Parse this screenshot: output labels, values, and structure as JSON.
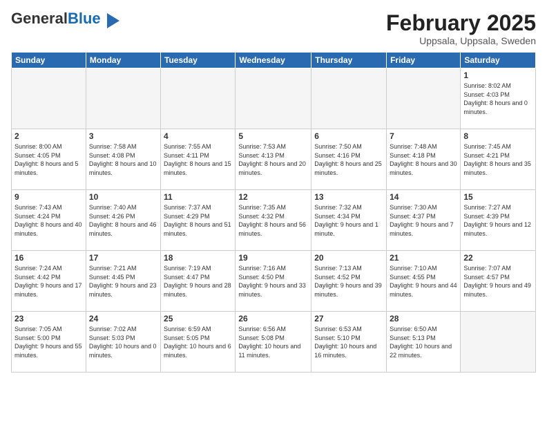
{
  "logo": {
    "general": "General",
    "blue": "Blue"
  },
  "title": "February 2025",
  "subtitle": "Uppsala, Uppsala, Sweden",
  "headers": [
    "Sunday",
    "Monday",
    "Tuesday",
    "Wednesday",
    "Thursday",
    "Friday",
    "Saturday"
  ],
  "weeks": [
    [
      {
        "num": "",
        "info": ""
      },
      {
        "num": "",
        "info": ""
      },
      {
        "num": "",
        "info": ""
      },
      {
        "num": "",
        "info": ""
      },
      {
        "num": "",
        "info": ""
      },
      {
        "num": "",
        "info": ""
      },
      {
        "num": "1",
        "info": "Sunrise: 8:02 AM\nSunset: 4:03 PM\nDaylight: 8 hours and 0 minutes."
      }
    ],
    [
      {
        "num": "2",
        "info": "Sunrise: 8:00 AM\nSunset: 4:05 PM\nDaylight: 8 hours and 5 minutes."
      },
      {
        "num": "3",
        "info": "Sunrise: 7:58 AM\nSunset: 4:08 PM\nDaylight: 8 hours and 10 minutes."
      },
      {
        "num": "4",
        "info": "Sunrise: 7:55 AM\nSunset: 4:11 PM\nDaylight: 8 hours and 15 minutes."
      },
      {
        "num": "5",
        "info": "Sunrise: 7:53 AM\nSunset: 4:13 PM\nDaylight: 8 hours and 20 minutes."
      },
      {
        "num": "6",
        "info": "Sunrise: 7:50 AM\nSunset: 4:16 PM\nDaylight: 8 hours and 25 minutes."
      },
      {
        "num": "7",
        "info": "Sunrise: 7:48 AM\nSunset: 4:18 PM\nDaylight: 8 hours and 30 minutes."
      },
      {
        "num": "8",
        "info": "Sunrise: 7:45 AM\nSunset: 4:21 PM\nDaylight: 8 hours and 35 minutes."
      }
    ],
    [
      {
        "num": "9",
        "info": "Sunrise: 7:43 AM\nSunset: 4:24 PM\nDaylight: 8 hours and 40 minutes."
      },
      {
        "num": "10",
        "info": "Sunrise: 7:40 AM\nSunset: 4:26 PM\nDaylight: 8 hours and 46 minutes."
      },
      {
        "num": "11",
        "info": "Sunrise: 7:37 AM\nSunset: 4:29 PM\nDaylight: 8 hours and 51 minutes."
      },
      {
        "num": "12",
        "info": "Sunrise: 7:35 AM\nSunset: 4:32 PM\nDaylight: 8 hours and 56 minutes."
      },
      {
        "num": "13",
        "info": "Sunrise: 7:32 AM\nSunset: 4:34 PM\nDaylight: 9 hours and 1 minute."
      },
      {
        "num": "14",
        "info": "Sunrise: 7:30 AM\nSunset: 4:37 PM\nDaylight: 9 hours and 7 minutes."
      },
      {
        "num": "15",
        "info": "Sunrise: 7:27 AM\nSunset: 4:39 PM\nDaylight: 9 hours and 12 minutes."
      }
    ],
    [
      {
        "num": "16",
        "info": "Sunrise: 7:24 AM\nSunset: 4:42 PM\nDaylight: 9 hours and 17 minutes."
      },
      {
        "num": "17",
        "info": "Sunrise: 7:21 AM\nSunset: 4:45 PM\nDaylight: 9 hours and 23 minutes."
      },
      {
        "num": "18",
        "info": "Sunrise: 7:19 AM\nSunset: 4:47 PM\nDaylight: 9 hours and 28 minutes."
      },
      {
        "num": "19",
        "info": "Sunrise: 7:16 AM\nSunset: 4:50 PM\nDaylight: 9 hours and 33 minutes."
      },
      {
        "num": "20",
        "info": "Sunrise: 7:13 AM\nSunset: 4:52 PM\nDaylight: 9 hours and 39 minutes."
      },
      {
        "num": "21",
        "info": "Sunrise: 7:10 AM\nSunset: 4:55 PM\nDaylight: 9 hours and 44 minutes."
      },
      {
        "num": "22",
        "info": "Sunrise: 7:07 AM\nSunset: 4:57 PM\nDaylight: 9 hours and 49 minutes."
      }
    ],
    [
      {
        "num": "23",
        "info": "Sunrise: 7:05 AM\nSunset: 5:00 PM\nDaylight: 9 hours and 55 minutes."
      },
      {
        "num": "24",
        "info": "Sunrise: 7:02 AM\nSunset: 5:03 PM\nDaylight: 10 hours and 0 minutes."
      },
      {
        "num": "25",
        "info": "Sunrise: 6:59 AM\nSunset: 5:05 PM\nDaylight: 10 hours and 6 minutes."
      },
      {
        "num": "26",
        "info": "Sunrise: 6:56 AM\nSunset: 5:08 PM\nDaylight: 10 hours and 11 minutes."
      },
      {
        "num": "27",
        "info": "Sunrise: 6:53 AM\nSunset: 5:10 PM\nDaylight: 10 hours and 16 minutes."
      },
      {
        "num": "28",
        "info": "Sunrise: 6:50 AM\nSunset: 5:13 PM\nDaylight: 10 hours and 22 minutes."
      },
      {
        "num": "",
        "info": ""
      }
    ]
  ]
}
